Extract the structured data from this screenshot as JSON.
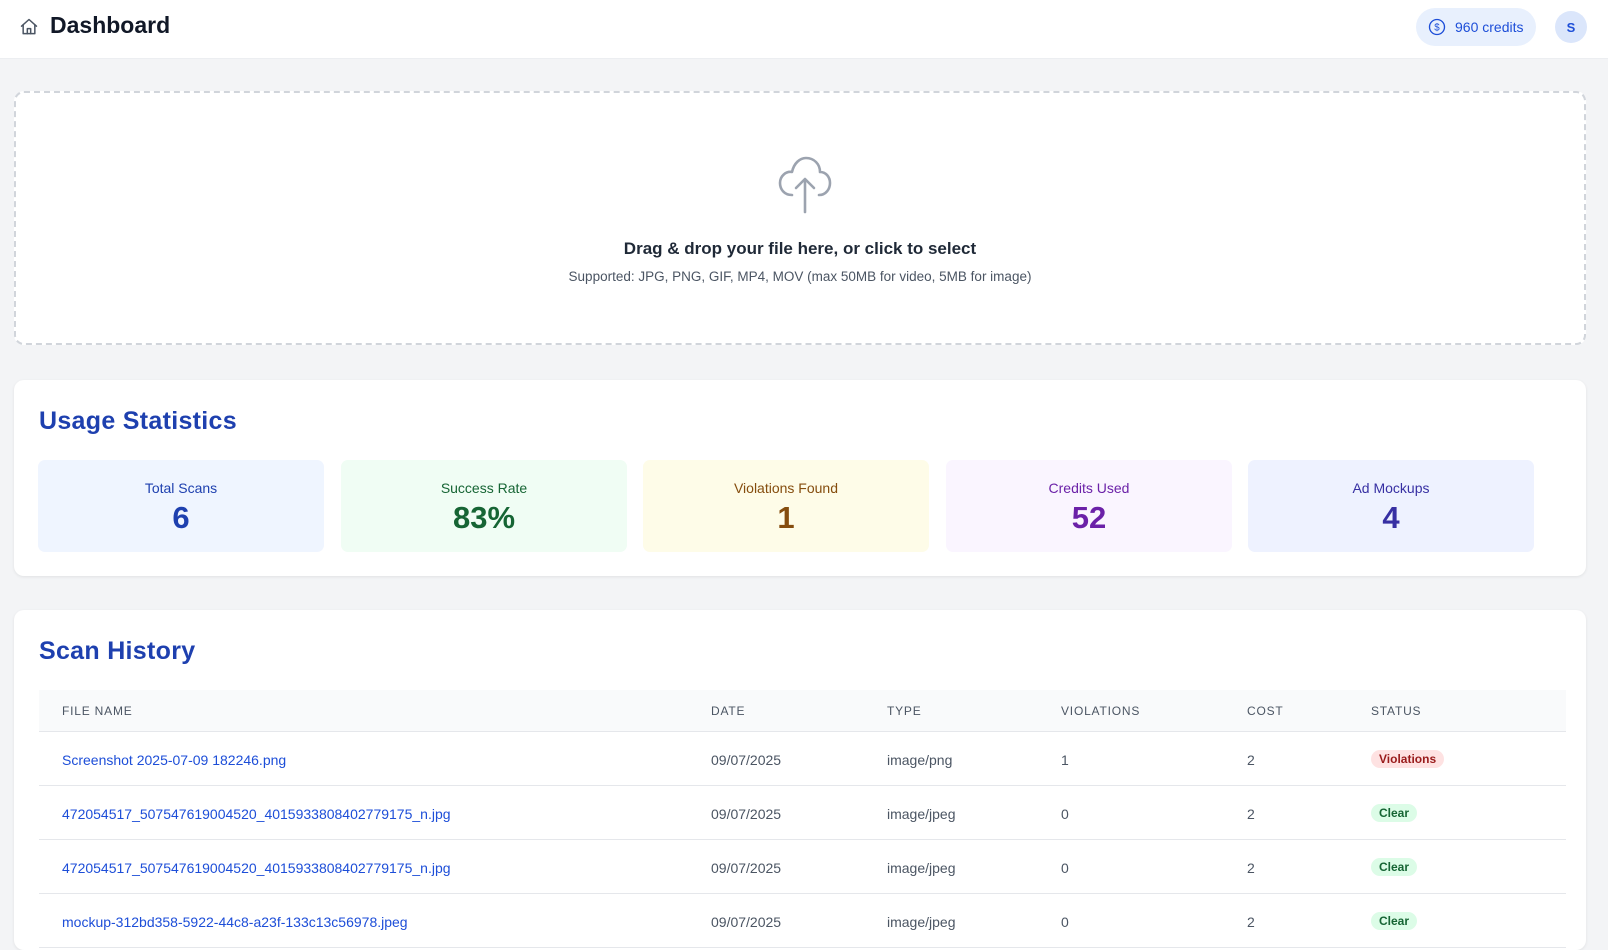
{
  "header": {
    "title": "Dashboard",
    "credits": "960 credits",
    "avatar_initial": "S",
    "home_icon": "home-icon",
    "credits_icon": "dollar-circle-icon"
  },
  "upload": {
    "icon": "cloud-upload-icon",
    "title": "Drag & drop your file here, or click to select",
    "subtitle": "Supported: JPG, PNG, GIF, MP4, MOV (max 50MB for video, 5MB for image)"
  },
  "usage": {
    "title": "Usage Statistics",
    "stats": [
      {
        "label": "Total Scans",
        "value": "6",
        "bg": "#eff5ff",
        "color": "#1e40af"
      },
      {
        "label": "Success Rate",
        "value": "83%",
        "bg": "#f0fdf4",
        "color": "#166534"
      },
      {
        "label": "Violations Found",
        "value": "1",
        "bg": "#fefce8",
        "color": "#854d0e"
      },
      {
        "label": "Credits Used",
        "value": "52",
        "bg": "#faf5ff",
        "color": "#6b21a8"
      },
      {
        "label": "Ad Mockups",
        "value": "4",
        "bg": "#eef2ff",
        "color": "#3730a3"
      }
    ]
  },
  "history": {
    "title": "Scan History",
    "columns": [
      "FILE NAME",
      "DATE",
      "TYPE",
      "VIOLATIONS",
      "COST",
      "STATUS"
    ],
    "rows": [
      {
        "file": "Screenshot 2025-07-09 182246.png",
        "date": "09/07/2025",
        "type": "image/png",
        "violations": "1",
        "cost": "2",
        "status": "Violations"
      },
      {
        "file": "472054517_507547619004520_4015933808402779175_n.jpg",
        "date": "09/07/2025",
        "type": "image/jpeg",
        "violations": "0",
        "cost": "2",
        "status": "Clear"
      },
      {
        "file": "472054517_507547619004520_4015933808402779175_n.jpg",
        "date": "09/07/2025",
        "type": "image/jpeg",
        "violations": "0",
        "cost": "2",
        "status": "Clear"
      },
      {
        "file": "mockup-312bd358-5922-44c8-a23f-133c13c56978.jpeg",
        "date": "09/07/2025",
        "type": "image/jpeg",
        "violations": "0",
        "cost": "2",
        "status": "Clear"
      }
    ]
  },
  "colors": {
    "accent": "#1e40af",
    "link": "#1d4ed8",
    "violations_badge": "#fee2e2",
    "clear_badge": "#dcfce7"
  }
}
